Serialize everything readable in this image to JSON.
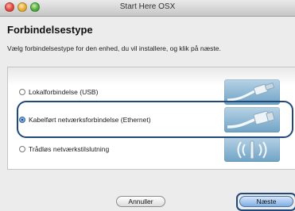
{
  "window": {
    "title": "Start Here OSX"
  },
  "heading": "Forbindelsestype",
  "subtext": "Vælg forbindelsestype for den enhed, du vil installere, og klik på næste.",
  "options": [
    {
      "label": "Lokalforbindelse (USB)",
      "selected": false,
      "icon": "usb-cable-icon"
    },
    {
      "label": "Kabelført netværksforbindelse (Ethernet)",
      "selected": true,
      "icon": "ethernet-cable-icon"
    },
    {
      "label": "Trådløs netværkstilslutning",
      "selected": false,
      "icon": "wireless-signal-icon"
    }
  ],
  "buttons": {
    "cancel": "Annuller",
    "next": "Næste"
  },
  "colors": {
    "highlight": "#20497a",
    "accent": "#4f8dd6"
  }
}
